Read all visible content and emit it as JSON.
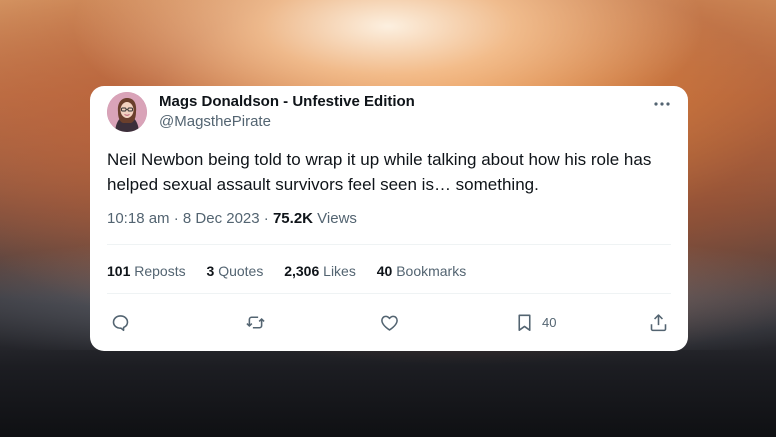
{
  "tweet": {
    "author_name": "Mags Donaldson - Unfestive Edition",
    "author_handle": "@MagsthePirate",
    "more_icon": "more-horizontal-icon",
    "text": "Neil Newbon being told to wrap it up while talking about how his role has helped sexual assault survivors feel seen is… something.",
    "time": "10:18 am",
    "date": "8 Dec 2023",
    "views_count": "75.2K",
    "views_label": "Views",
    "separator": "·"
  },
  "stats": {
    "reposts_count": "101",
    "reposts_label": "Reposts",
    "quotes_count": "3",
    "quotes_label": "Quotes",
    "likes_count": "2,306",
    "likes_label": "Likes",
    "bookmarks_count": "40",
    "bookmarks_label": "Bookmarks"
  },
  "actions": {
    "reply_icon": "reply-icon",
    "repost_icon": "repost-icon",
    "like_icon": "heart-icon",
    "bookmark_icon": "bookmark-icon",
    "bookmark_count": "40",
    "share_icon": "share-icon"
  },
  "colors": {
    "text_primary": "#0f1419",
    "text_secondary": "#536471",
    "divider": "#eff3f4",
    "card_bg": "#ffffff"
  }
}
